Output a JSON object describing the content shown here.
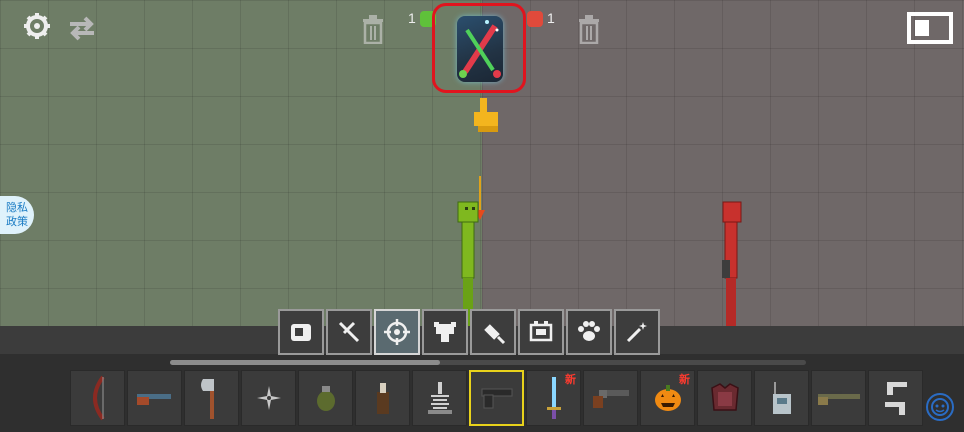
{
  "top_bar": {
    "settings_icon": "gear-icon",
    "swap_icon": "swap-arrows-icon",
    "green_score": "1",
    "red_score": "1",
    "trash_icon": "trash-icon",
    "window_toggle_icon": "window-toggle-icon"
  },
  "featured_item": {
    "icon": "crossed-swords-chest-icon",
    "highlight_color": "#e0141e"
  },
  "privacy_button": {
    "line1": "隐私",
    "line2": "政策"
  },
  "colors": {
    "green_team": "#7fb81f",
    "red_team": "#c8312d",
    "selected_border": "#e8d21b"
  },
  "categories": [
    {
      "icon": "container-icon"
    },
    {
      "icon": "melee-weapon-icon"
    },
    {
      "icon": "crosshair-icon",
      "active": true
    },
    {
      "icon": "body-parts-icon"
    },
    {
      "icon": "syringe-icon"
    },
    {
      "icon": "machine-icon"
    },
    {
      "icon": "paw-icon"
    },
    {
      "icon": "magic-wand-icon"
    }
  ],
  "items": [
    {
      "icon": "bow-icon"
    },
    {
      "icon": "shotgun-icon"
    },
    {
      "icon": "axe-icon"
    },
    {
      "icon": "shuriken-icon"
    },
    {
      "icon": "grenade-icon"
    },
    {
      "icon": "molotov-icon"
    },
    {
      "icon": "spring-trap-icon"
    },
    {
      "icon": "pistol-icon",
      "selected": true
    },
    {
      "icon": "sword-icon",
      "new_label": "新"
    },
    {
      "icon": "revolver-icon"
    },
    {
      "icon": "pumpkin-icon",
      "new_label": "新"
    },
    {
      "icon": "armor-icon"
    },
    {
      "icon": "radio-icon"
    },
    {
      "icon": "rifle-icon"
    },
    {
      "icon": "dual-pistols-icon"
    }
  ]
}
